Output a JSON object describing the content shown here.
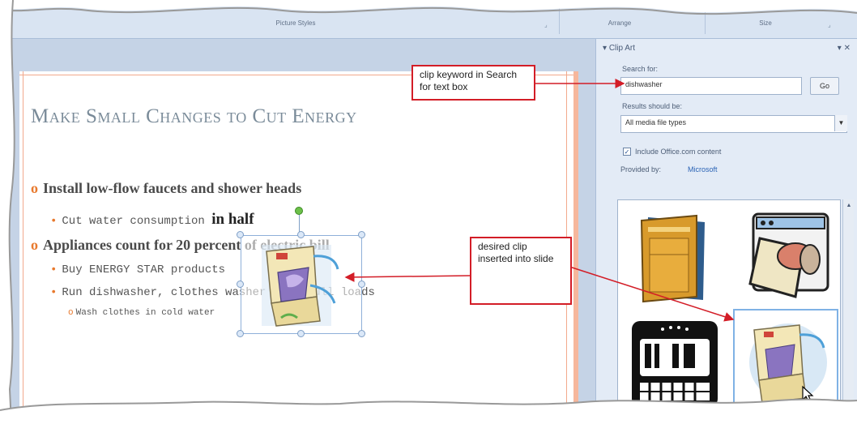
{
  "ribbon": {
    "groups": [
      "Picture Styles",
      "Arrange",
      "Size"
    ]
  },
  "slide": {
    "title": "Make Small Changes to Cut Energy",
    "bullets": {
      "b1": "Install low-flow faucets and shower heads",
      "b1a_pre": "Cut water consumption ",
      "b1a_bold": "in half",
      "b2": "Appliances count for 20 percent of electric bill",
      "b2a": "Buy ENERGY STAR products",
      "b2b": "Run dishwasher, clothes washer with full loads",
      "b2b1": "Wash clothes in cold water"
    }
  },
  "pane": {
    "title": "Clip Art",
    "search_label": "Search for:",
    "search_value": "dishwasher",
    "go_label": "Go",
    "results_label": "Results should be:",
    "results_value": "All media file types",
    "include_label": "Include Office.com content",
    "provided_label": "Provided by:",
    "provider": "Microsoft"
  },
  "callouts": {
    "keyword": "clip keyword in Search for text box",
    "desired": "desired clip inserted into slide"
  },
  "colors": {
    "callout_border": "#d31d27",
    "accent_orange": "#e8792d",
    "selection_blue": "#7fb2e5"
  },
  "icons": [
    "dishwasher-clip-gold",
    "dishwasher-clip-open",
    "kitchen-symbol-clip",
    "dishwasher-clip-selected",
    "mouse-pointer-icon"
  ]
}
